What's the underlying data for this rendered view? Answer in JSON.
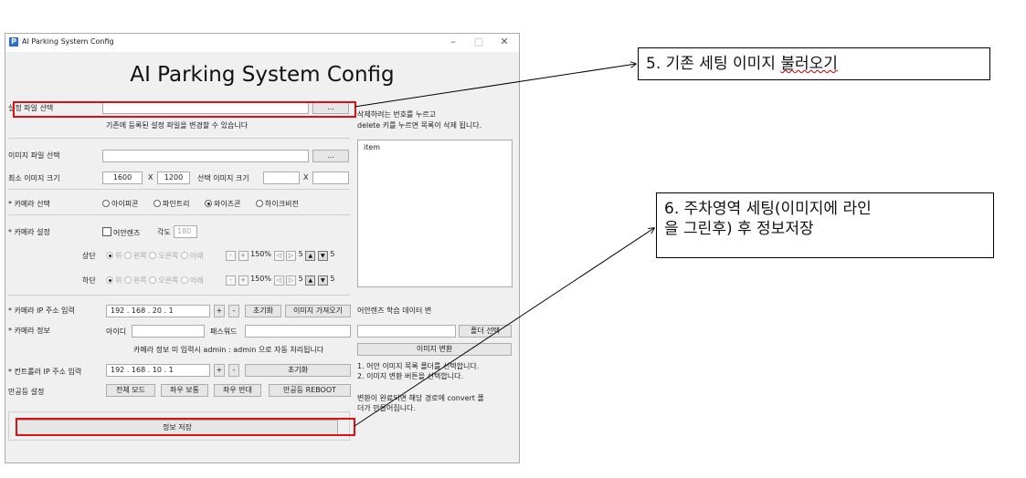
{
  "window": {
    "title": "AI Parking System Config",
    "logo_letter": "P",
    "minimize": "–",
    "maximize": "□",
    "close": "✕"
  },
  "app": {
    "heading": "AI Parking System Config"
  },
  "settings_file": {
    "label": "설정 파일 선택",
    "value": "",
    "browse": "...",
    "hint": "기존에 등록된 설정 파일을 변경할 수 있습니다"
  },
  "image_file": {
    "label": "이미지 파일 선택",
    "value": "",
    "browse": "..."
  },
  "min_image_size": {
    "label": "최소 이미지 크기",
    "width": "1600",
    "x1": "X",
    "height": "1200",
    "selected_label": "선택 이미지 크기",
    "sel_width": "",
    "x2": "X",
    "sel_height": ""
  },
  "camera_select": {
    "label": "* 카메라 선택",
    "options": [
      "아이피콘",
      "파인트리",
      "와이즈콘",
      "하이크비전"
    ],
    "selected": "와이즈콘"
  },
  "camera_setting": {
    "label": "* 카메라 설정",
    "fisheye": "어안렌즈",
    "angle_label": "각도",
    "angle_value": "180",
    "upper": {
      "label": "상단",
      "options": [
        "위",
        "왼쪽",
        "오른쪽",
        "아래"
      ],
      "minus": "-",
      "plus": "+",
      "zoom": "150%",
      "left": "◁",
      "right": "▷",
      "lr_value": "5",
      "up": "▲",
      "down": "▼",
      "ud_value": "5"
    },
    "lower": {
      "label": "하단",
      "options": [
        "위",
        "왼쪽",
        "오른쪽",
        "아래"
      ],
      "minus": "-",
      "plus": "+",
      "zoom": "150%",
      "left": "◁",
      "right": "▷",
      "lr_value": "5",
      "up": "▲",
      "down": "▼",
      "ud_value": "5"
    }
  },
  "camera_ip": {
    "label": "* 카메라 IP 주소 입력",
    "value": "192  .  168  .  20  .  1",
    "plus": "+",
    "minus": "-",
    "reset": "초기화",
    "load_image": "이미지 가져오기"
  },
  "camera_info": {
    "label": "* 카메라 정보",
    "id_label": "아이디",
    "id_value": "",
    "pw_label": "패스워드",
    "pw_value": "",
    "hint": "카메라 정보 미 입력시 admin : admin 으로 자동 처리됩니다"
  },
  "controller_ip": {
    "label": "* 컨트롤러 IP 주소 입력",
    "value": "192  .  168  .  10  .  1",
    "plus": "+",
    "minus": "-",
    "reset": "초기화"
  },
  "full_mode": {
    "label": "만공등 설정",
    "buttons": [
      "전체 모드",
      "좌우 보통",
      "좌우 반대",
      "만공등 REBOOT"
    ]
  },
  "save_button": "정보 저장",
  "right_panel": {
    "delete_hint_1": "삭제하려는 번호를 누르고",
    "delete_hint_2": "delete 키를 누르면 목록이 삭제 됩니다.",
    "list_items": [
      "item"
    ],
    "fisheye_title": "어안렌즈 학습 데이터 변",
    "folder_value": "",
    "folder_button": "폴더 선택",
    "convert_button": "이미지 변환",
    "step1": "1. 어안 이미지 목록 폴더를 선택합니다.",
    "step2": "2. 이미지 변환 버튼을 선택합니다.",
    "done_1": "변환이 완료되면 해당 경로에 convert 폴",
    "done_2": "더가 만들어집니다."
  },
  "annotations": {
    "callout_5": "5. 기존 세팅 이미지 불러오기",
    "callout_5_prefix": "5. 기존 세팅 이미지 ",
    "callout_5_squig": "불러오기",
    "callout_6_line1": "6. 주차영역 세팅(이미지에 라인",
    "callout_6_line2": "을 그린후) 후 정보저장",
    "highlight_color": "#e01010"
  }
}
